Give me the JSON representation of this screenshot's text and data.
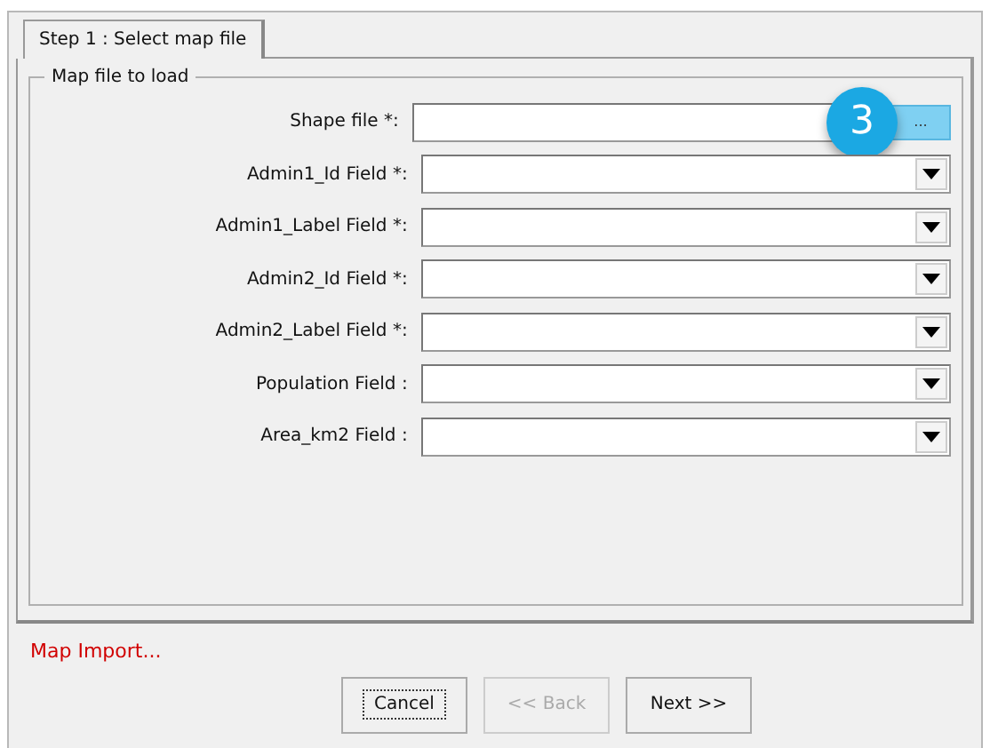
{
  "tabs": [
    {
      "label": "Step 1 : Select map file",
      "selected": true
    }
  ],
  "group": {
    "title": "Map file to load",
    "fields": [
      {
        "label": "Shape file *:",
        "kind": "file",
        "browse_label": "...",
        "callout": "3"
      },
      {
        "label": "Admin1_Id Field *:",
        "kind": "combo"
      },
      {
        "label": "Admin1_Label Field *:",
        "kind": "combo"
      },
      {
        "label": "Admin2_Id Field *:",
        "kind": "combo"
      },
      {
        "label": "Admin2_Label Field *:",
        "kind": "combo"
      },
      {
        "label": "Population Field :",
        "kind": "combo"
      },
      {
        "label": "Area_km2 Field :",
        "kind": "combo"
      }
    ]
  },
  "status": "Map Import...",
  "buttons": [
    {
      "label": "Cancel",
      "disabled": false,
      "focused": true
    },
    {
      "label": "<< Back",
      "disabled": true,
      "focused": false
    },
    {
      "label": "Next >>",
      "disabled": false,
      "focused": false
    }
  ]
}
